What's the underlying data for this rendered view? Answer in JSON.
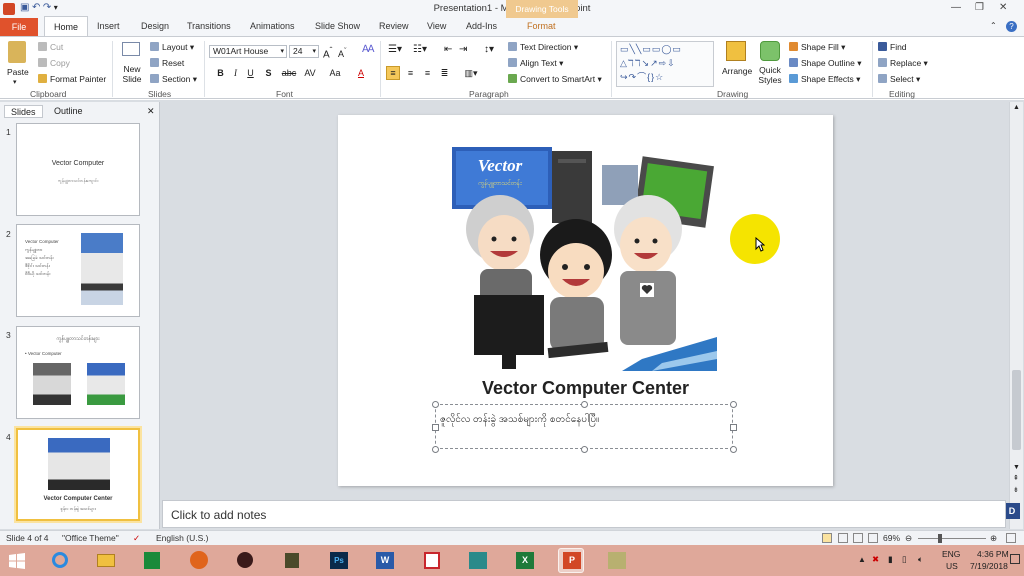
{
  "app": {
    "title": "Presentation1 - Microsoft PowerPoint",
    "contextual_tab": "Drawing Tools"
  },
  "tabs": [
    "File",
    "Home",
    "Insert",
    "Design",
    "Transitions",
    "Animations",
    "Slide Show",
    "Review",
    "View",
    "Add-Ins",
    "Format"
  ],
  "ribbon": {
    "clipboard": {
      "paste": "Paste",
      "cut": "Cut",
      "copy": "Copy",
      "format_painter": "Format Painter",
      "label": "Clipboard"
    },
    "slides": {
      "new_slide": "New Slide",
      "layout": "Layout",
      "reset": "Reset",
      "section": "Section",
      "label": "Slides"
    },
    "font": {
      "name": "W01Art House",
      "size": "24",
      "label": "Font"
    },
    "paragraph": {
      "text_direction": "Text Direction",
      "align_text": "Align Text",
      "convert_smartart": "Convert to SmartArt",
      "label": "Paragraph"
    },
    "drawing": {
      "arrange": "Arrange",
      "quick_styles": "Quick Styles",
      "shape_fill": "Shape Fill",
      "shape_outline": "Shape Outline",
      "shape_effects": "Shape Effects",
      "label": "Drawing"
    },
    "editing": {
      "find": "Find",
      "replace": "Replace",
      "select": "Select",
      "label": "Editing"
    }
  },
  "panel": {
    "tabs": [
      "Slides",
      "Outline"
    ],
    "slide_numbers": [
      "1",
      "2",
      "3",
      "4"
    ]
  },
  "thumbs": {
    "s1_title": "Vector Computer",
    "s1_sub": "ကွန်ပျူတာသင်တန်းကျောင်း",
    "s2_lines": [
      "Vector Computer",
      "ကွန်ပျူတာ",
      "အခြေခံ သင်တန်း",
      "ဒီဇိုင်း သင်တန်း",
      "ဗီဒီယို သင်တန်း"
    ],
    "s3_title": "ကွန်ပျူတာသင်တန်းများ",
    "s3_bullet": "• Vector Computer",
    "s4_title": "Vector Computer Center",
    "s4_sub": "ဇွန်လ တန်းခွဲ အသစ်များ"
  },
  "slide": {
    "picture": {
      "sign_title": "Vector",
      "sign_sub": "ကွန်ပျူတာသင်တန်း"
    },
    "title": "Vector Computer Center",
    "subtitle": "ဇူလိုင်လ တန်းခွဲ အသစ်များကို စတင်နေပါပြီ။"
  },
  "notes": "Click to add notes",
  "status": {
    "slide": "Slide 4 of 4",
    "theme": "\"Office Theme\"",
    "language": "English (U.S.)",
    "zoom": "69%"
  },
  "tray": {
    "lang": "ENG",
    "region": "US",
    "time": "4:36 PM",
    "date": "7/19/2018"
  },
  "colors": {
    "accent": "#d24726",
    "file_tab": "#e0522c",
    "contextual": "#f0c98f",
    "taskbar": "#dfa89a"
  }
}
